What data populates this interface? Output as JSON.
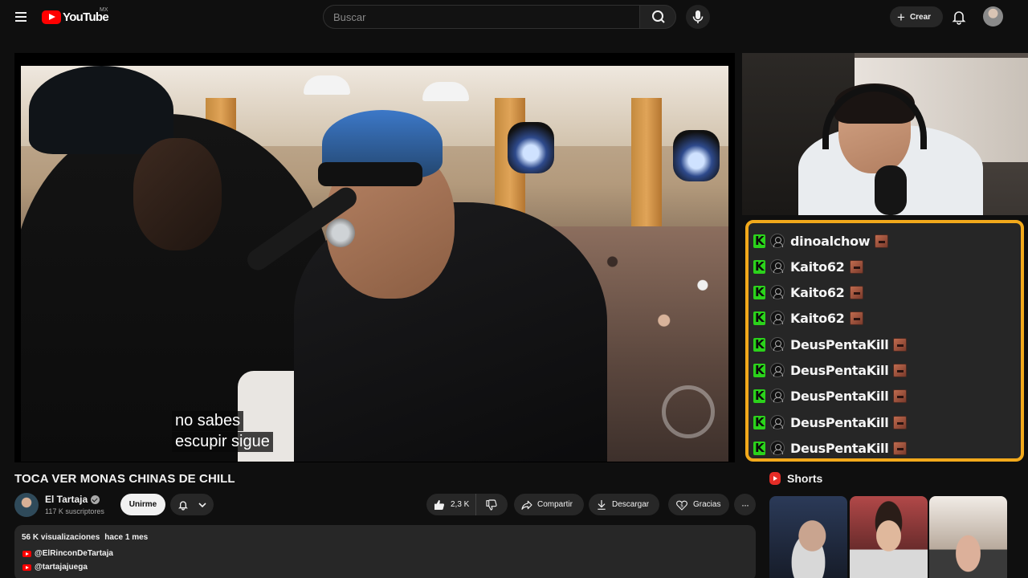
{
  "header": {
    "logo_text": "YouTube",
    "country": "MX",
    "search_placeholder": "Buscar",
    "create_label": "Crear"
  },
  "video": {
    "subtitle_lines": [
      "no sabes",
      "escupir sigue"
    ]
  },
  "chat": {
    "messages": [
      {
        "user": "dinoalchow"
      },
      {
        "user": "Kaito62"
      },
      {
        "user": "Kaito62"
      },
      {
        "user": "Kaito62"
      },
      {
        "user": "DeusPentaKill"
      },
      {
        "user": "DeusPentaKill"
      },
      {
        "user": "DeusPentaKill"
      },
      {
        "user": "DeusPentaKill"
      },
      {
        "user": "DeusPentaKill"
      }
    ],
    "border_color": "#f2a91b",
    "badge_color": "#2bd21b"
  },
  "title": "TOCA VER MONAS CHINAS DE CHILL",
  "channel": {
    "name": "El Tartaja",
    "subscribers": "117 K suscriptores",
    "join_label": "Unirme"
  },
  "actions": {
    "likes": "2,3 K",
    "share_label": "Compartir",
    "download_label": "Descargar",
    "thanks_label": "Gracias"
  },
  "description": {
    "views": "56 K visualizaciones",
    "date": "hace 1 mes",
    "links": [
      "@ElRinconDeTartaja",
      "@tartajajuega"
    ]
  },
  "shorts": {
    "heading": "Shorts"
  }
}
